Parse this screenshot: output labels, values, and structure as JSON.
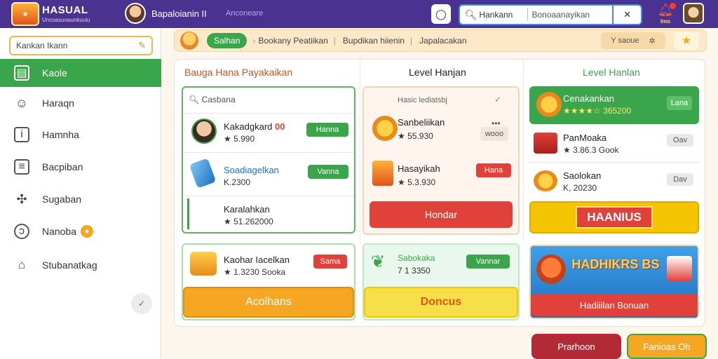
{
  "header": {
    "brand": "HASUAL",
    "brand_sub": "Uncoasuoaunkuuiu",
    "user_name": "Bapaloianin II",
    "status": "Anconeare",
    "search_value": "Hankann",
    "search_placeholder": "Bonoaanayikan",
    "close": "✕",
    "bell_label": "Imo"
  },
  "sidebar": {
    "search_value": "Kankan Ikann",
    "items": [
      {
        "label": "Kaole",
        "icon": "book-icon"
      },
      {
        "label": "Haraqn",
        "icon": "user-icon"
      },
      {
        "label": "Hamnha",
        "icon": "info-icon"
      },
      {
        "label": "Bacpiban",
        "icon": "document-icon"
      },
      {
        "label": "Sugaban",
        "icon": "puzzle-icon"
      },
      {
        "label": "Nanoba",
        "icon": "circle-icon"
      },
      {
        "label": "Stubanatkag",
        "icon": "tag-icon"
      }
    ],
    "collapse": "✓"
  },
  "breadcrumb": {
    "home": "Salhan",
    "crumb1": "Bookany Peatiikan",
    "crumb2": "Bupdikan hiienin",
    "crumb3": "Japalacakan",
    "filter": "Y saoue"
  },
  "col1": {
    "title": "Bauga Hana Payakaikan",
    "search": "Casbana",
    "rows": [
      {
        "name": "Kakadgkard",
        "name_accent": "00",
        "value": "★ 5.990",
        "button": "Hanna"
      },
      {
        "name": "Soadiagelkan",
        "value": "K.2300",
        "button": "Vanna"
      },
      {
        "name": "Karalahkan",
        "value": "★ 51.262000",
        "button": ""
      }
    ],
    "card2": {
      "name": "Kaohar Iacelkan",
      "value": "★ 1.3230 Sooka",
      "button": "Sama"
    },
    "big_button": "Acolhans"
  },
  "col2": {
    "title": "Level Hanjan",
    "head": "Hasic lediatsbj",
    "rows": [
      {
        "name": "Sanbeliikan",
        "value": "★ 55.930",
        "button": "wooo"
      },
      {
        "name": "Hasayikah",
        "value": "★ 5.3.930",
        "button": "Hana"
      }
    ],
    "big_button": "Hondar",
    "card2": {
      "name": "Sabokaka",
      "value": "7 1 3350",
      "button": "Vannar"
    },
    "bonus_button": "Doncus"
  },
  "col3": {
    "title": "Level Hanlan",
    "rows": [
      {
        "name": "Cenakankan",
        "value": "★★★★☆ 365200",
        "button": "Lana"
      },
      {
        "name": "PanMoaka",
        "value": "★ 3.86.3 Gook",
        "button": "Oav"
      },
      {
        "name": "Saolokan",
        "value": "K, 20230",
        "button": "Dav"
      }
    ],
    "banner": "HAANIUS",
    "promo": "HADHIKRS BS",
    "promo_button": "Hadiiilan Bonuan"
  },
  "footer": {
    "primary": "Prarhoon",
    "secondary": "Fanioas Oh"
  },
  "colors": {
    "topbar": "#4a3290",
    "accent_green": "#3aa54a",
    "accent_red": "#e0413a",
    "accent_orange": "#f5a623"
  }
}
